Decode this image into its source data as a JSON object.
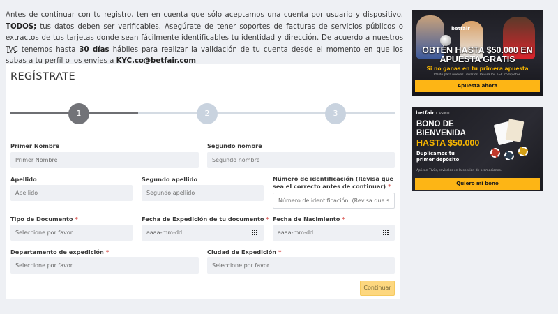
{
  "notice": {
    "p1": "Antes de continuar con tu registro, ten en cuenta que sólo aceptamos una cuenta por usuario y dispositivo.",
    "todos": "TODOS;",
    "p2": "tus datos deben ser verificables. Asegúrate de tener soportes de facturas de servicios públicos o extractos de tus tarjetas donde sean fácilmente identificables tu identidad y dirección. De acuerdo a nuestros",
    "tyc": "TyC",
    "p3": "tenemos hasta",
    "dias": "30 días",
    "p4": "hábiles para realizar la validación de tu cuenta desde el momento en que los subas a tu perfil o los envíes a",
    "email": "KYC.co@betfair.com"
  },
  "form": {
    "title": "REGÍSTRATE",
    "steps": [
      "1",
      "2",
      "3"
    ],
    "required_mark": "*",
    "primer_nombre": {
      "label": "Primer Nombre",
      "placeholder": "Primer Nombre"
    },
    "segundo_nombre": {
      "label": "Segundo nombre",
      "placeholder": "Segundo nombre"
    },
    "apellido": {
      "label": "Apellido",
      "placeholder": "Apellido"
    },
    "segundo_apellido": {
      "label": "Segundo apellido",
      "placeholder": "Segundo apellido"
    },
    "numero_id": {
      "label": "Número de identificación (Revisa que sea el correcto antes de continuar)",
      "placeholder": "Número de identificación  (Revisa que sea el correcto antes de continuar)"
    },
    "tipo_documento": {
      "label": "Tipo de Documento",
      "value": "Seleccione por favor"
    },
    "fecha_expedicion": {
      "label": "Fecha de Expedición de tu documento",
      "value": "aaaa-mm-dd"
    },
    "fecha_nacimiento": {
      "label": "Fecha de Nacimiento",
      "value": "aaaa-mm-dd"
    },
    "departamento": {
      "label": "Departamento de expedición",
      "value": "Seleccione por favor"
    },
    "ciudad": {
      "label": "Ciudad de Expedición",
      "value": "Seleccione por favor"
    },
    "continue_label": "Continuar"
  },
  "ads": {
    "ad1": {
      "brand": "betfair",
      "headline": "OBTÉN HASTA $50.000 EN APUESTA GRATIS",
      "sub": "Si no ganas en tu primera apuesta",
      "fine": "Válido para nuevos usuarios. Revisa los T&C completos.",
      "cta": "Apuesta ahora"
    },
    "ad2": {
      "brand": "betfair",
      "brand_sub": "CASINO",
      "headline": "BONO DE BIENVENIDA",
      "amount": "HASTA $50.000",
      "dup": "Duplicamos tu primer depósito",
      "fine": "Aplican T&Cs, revísalos en la sección de promociones.",
      "cta": "Quiero mi bono"
    }
  },
  "colors": {
    "accent": "#fdb515",
    "continue_bg": "#fdd77f",
    "step_active": "#727378",
    "step_inactive": "#c9d3df",
    "required": "#d9534f"
  }
}
